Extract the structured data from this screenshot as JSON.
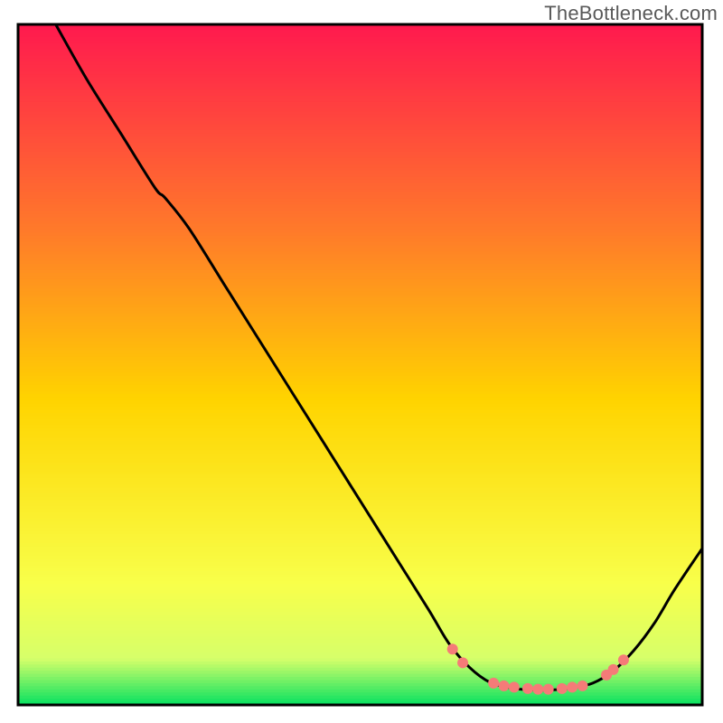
{
  "watermark": "TheBottleneck.com",
  "chart_data": {
    "type": "line",
    "title": "",
    "xlabel": "",
    "ylabel": "",
    "xlim": [
      0,
      100
    ],
    "ylim": [
      0,
      100
    ],
    "background_gradient": {
      "top": "#ff1a4e",
      "mid_upper": "#ff7a2a",
      "mid": "#ffd400",
      "mid_lower": "#f8ff4a",
      "band": "#d6ff6a",
      "bottom": "#00e060"
    },
    "series": [
      {
        "name": "curve",
        "color": "#000000",
        "points": [
          {
            "x": 5.5,
            "y": 100
          },
          {
            "x": 10,
            "y": 92
          },
          {
            "x": 15,
            "y": 84
          },
          {
            "x": 20,
            "y": 76
          },
          {
            "x": 21.5,
            "y": 74.5
          },
          {
            "x": 25,
            "y": 70
          },
          {
            "x": 30,
            "y": 62
          },
          {
            "x": 35,
            "y": 54
          },
          {
            "x": 40,
            "y": 46
          },
          {
            "x": 45,
            "y": 38
          },
          {
            "x": 50,
            "y": 30
          },
          {
            "x": 55,
            "y": 22
          },
          {
            "x": 60,
            "y": 14
          },
          {
            "x": 63,
            "y": 9
          },
          {
            "x": 66,
            "y": 5.5
          },
          {
            "x": 69,
            "y": 3.3
          },
          {
            "x": 72,
            "y": 2.5
          },
          {
            "x": 75,
            "y": 2.2
          },
          {
            "x": 78,
            "y": 2.2
          },
          {
            "x": 81,
            "y": 2.5
          },
          {
            "x": 84,
            "y": 3.2
          },
          {
            "x": 87,
            "y": 5
          },
          {
            "x": 90,
            "y": 8
          },
          {
            "x": 93,
            "y": 12
          },
          {
            "x": 96,
            "y": 17
          },
          {
            "x": 100,
            "y": 23
          }
        ]
      }
    ],
    "markers": {
      "color": "#f57b78",
      "radius_px": 6,
      "points": [
        {
          "x": 63.5,
          "y": 8.2
        },
        {
          "x": 65.0,
          "y": 6.2
        },
        {
          "x": 69.5,
          "y": 3.2
        },
        {
          "x": 71.0,
          "y": 2.8
        },
        {
          "x": 72.5,
          "y": 2.6
        },
        {
          "x": 74.5,
          "y": 2.4
        },
        {
          "x": 76.0,
          "y": 2.3
        },
        {
          "x": 77.5,
          "y": 2.3
        },
        {
          "x": 79.5,
          "y": 2.4
        },
        {
          "x": 81.0,
          "y": 2.6
        },
        {
          "x": 82.5,
          "y": 2.8
        },
        {
          "x": 86.0,
          "y": 4.4
        },
        {
          "x": 87.0,
          "y": 5.2
        },
        {
          "x": 88.5,
          "y": 6.6
        }
      ]
    }
  }
}
